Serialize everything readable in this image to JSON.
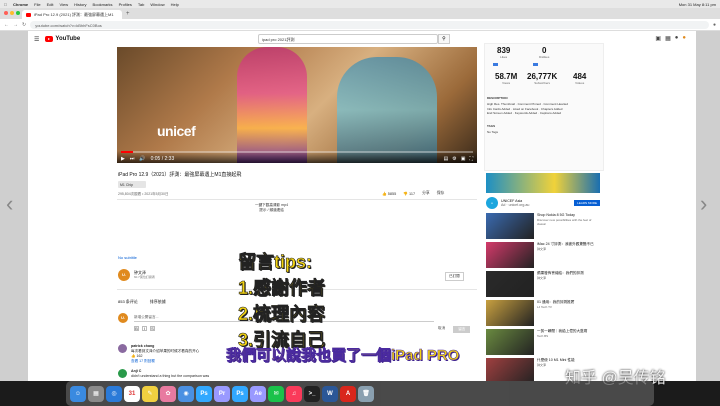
{
  "menubar": {
    "app": "Chrome",
    "items": [
      "File",
      "Edit",
      "View",
      "History",
      "Bookmarks",
      "Profiles",
      "Tab",
      "Window",
      "Help"
    ],
    "clock": "Mon 31 May 8:11 pm"
  },
  "tab": {
    "title": "iPad Pro 12.9 (2021) 評測：最強屏幕遇上M1"
  },
  "address": {
    "url": "youtube.com/watch?v=kBhhFsC0Bos"
  },
  "youtube": {
    "logo": "YouTube",
    "search_value": "ipad pro 2021評測",
    "video_overlay_text": "unicef",
    "time": "0:05 / 2:33",
    "title": "iPad Pro 12.9（2021）評測：最強屏幕遇上M1直接起飛",
    "chip": "M1 Chip",
    "meta": "295,804次觀看 • 2021年5月30日",
    "actions": {
      "like": "5855",
      "dislike": "117",
      "share": "分享",
      "save": "保存"
    },
    "description": [
      "一鍵下載高清影 mp4",
      "提示 / 頻道連結"
    ],
    "no_subtitle": "No subtitle",
    "channel": {
      "avatar": "U.",
      "name": "钟文泽",
      "subs": "60.7萬位訂閱者"
    },
    "subscribe": "已訂閱",
    "comments": {
      "count": "853 条评论",
      "sort": "排序依據",
      "placeholder": "新增公開留言...",
      "cancel": "取消",
      "submit": "留言",
      "items": [
        {
          "author": "patrick chang",
          "text": "每次看到文泽介绍苹果的时候才看真的开心",
          "likes": "162",
          "reply": "查看 17 則回覆"
        },
        {
          "author": "Anji C",
          "text": "didn't understand a thing but the comparison was",
          "likes": "1",
          "reply": "回覆"
        }
      ]
    }
  },
  "stats": {
    "likes": "839",
    "likes_label": "Likes",
    "dislikes": "0",
    "dislikes_label": "Dislikes",
    "views": "58.7M",
    "views_label": "Views",
    "subs": "26,777K",
    "subs_label": "Subscribers",
    "videos": "484",
    "videos_label": "Videos",
    "section_title": "DESCRIPTION",
    "features": [
      "High Res. Thumbnail",
      "Comment Pinned",
      "Comment Hearted",
      "Info Cards Added",
      "Liked on Facebook",
      "Chapters Added",
      "End Screen Added",
      "Keywords Added",
      "Captions Added"
    ],
    "tags_title": "TAGS",
    "tags": "No Tags"
  },
  "ad": {
    "channel": "UNICEF Asia",
    "sub": "Ad · unicef.org.au",
    "learn": "LEARN MORE"
  },
  "recommendations": [
    {
      "title": "Shop Nokia 8 5G Today",
      "sub": "Discover new possibilities with the feel of classic"
    },
    {
      "title": "iMac 24 寸評測：我被外觀驚艷不已",
      "sub": "钟文泽"
    },
    {
      "title": "蘋果發佈會總結：我們的評測",
      "sub": "钟文泽"
    },
    {
      "title": "01 通用：我的評測推薦",
      "sub": "LJ Tech TV"
    },
    {
      "title": "一剪一瞬間｜我給上億的大藍寫",
      "sub": "Tech BS"
    },
    {
      "title": "什麼使 10 M1 Mini 性能",
      "sub": "钟文泽"
    }
  ],
  "overlay": {
    "tips": [
      "留言tips:",
      "1.感謝作者",
      "2.梳理內容",
      "3.引流自己"
    ],
    "caption": "我們可以說我也買了一個iPad PRO",
    "watermark": "知乎 @吴传铭"
  },
  "dock_icons": [
    "finder-icon",
    "launchpad-icon",
    "safari-icon",
    "calendar-icon",
    "notes-icon",
    "photos-icon",
    "chrome-icon",
    "ps-icon",
    "pr-icon",
    "ps2-icon",
    "ae-icon",
    "wechat-icon",
    "music-icon",
    "terminal-icon",
    "word-icon",
    "acrobat-icon",
    "trash-icon"
  ]
}
